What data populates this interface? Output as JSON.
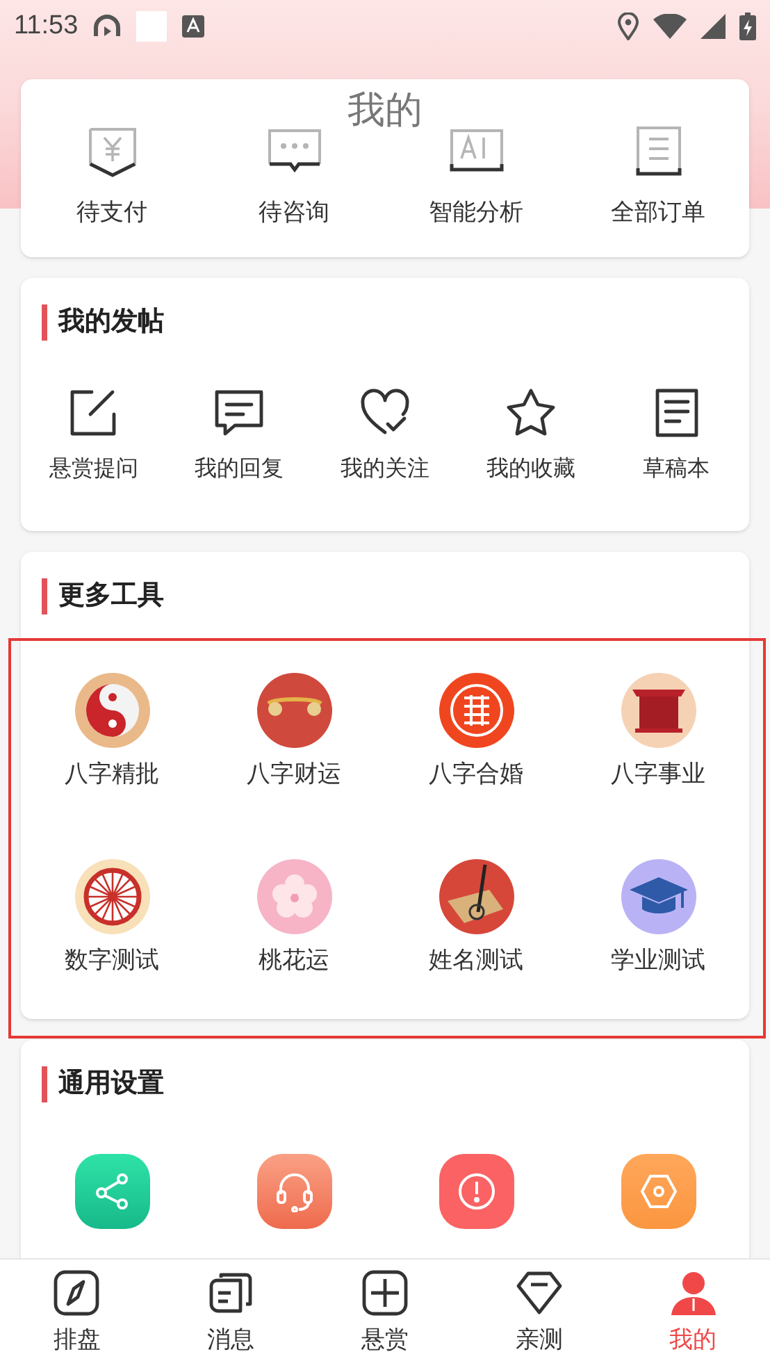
{
  "status_bar": {
    "time": "11:53"
  },
  "header": {
    "title": "我的"
  },
  "orders": [
    {
      "kind": "pay",
      "label": "待支付"
    },
    {
      "kind": "consult",
      "label": "待咨询"
    },
    {
      "kind": "ai",
      "label": "智能分析"
    },
    {
      "kind": "list",
      "label": "全部订单"
    }
  ],
  "posts": {
    "title": "我的发帖",
    "items": [
      {
        "kind": "edit",
        "label": "悬赏提问"
      },
      {
        "kind": "reply",
        "label": "我的回复"
      },
      {
        "kind": "heart",
        "label": "我的关注"
      },
      {
        "kind": "star",
        "label": "我的收藏"
      },
      {
        "kind": "draft",
        "label": "草稿本"
      }
    ]
  },
  "tools": {
    "title": "更多工具",
    "items": [
      {
        "kind": "yinyang",
        "label": "八字精批"
      },
      {
        "kind": "ruyi",
        "label": "八字财运"
      },
      {
        "kind": "xi",
        "label": "八字合婚"
      },
      {
        "kind": "gate",
        "label": "八字事业"
      },
      {
        "kind": "wheel",
        "label": "数字测试"
      },
      {
        "kind": "blossom",
        "label": "桃花运"
      },
      {
        "kind": "brush",
        "label": "姓名测试"
      },
      {
        "kind": "cap",
        "label": "学业测试"
      }
    ]
  },
  "settings": {
    "title": "通用设置",
    "items": [
      {
        "kind": "share"
      },
      {
        "kind": "headset"
      },
      {
        "kind": "notice"
      },
      {
        "kind": "hex"
      }
    ]
  },
  "tab_bar": [
    {
      "kind": "compass",
      "label": "排盘",
      "selected": false
    },
    {
      "kind": "messages",
      "label": "消息",
      "selected": false
    },
    {
      "kind": "plus",
      "label": "悬赏",
      "selected": false
    },
    {
      "kind": "gem",
      "label": "亲测",
      "selected": false
    },
    {
      "kind": "person",
      "label": "我的",
      "selected": true
    }
  ]
}
